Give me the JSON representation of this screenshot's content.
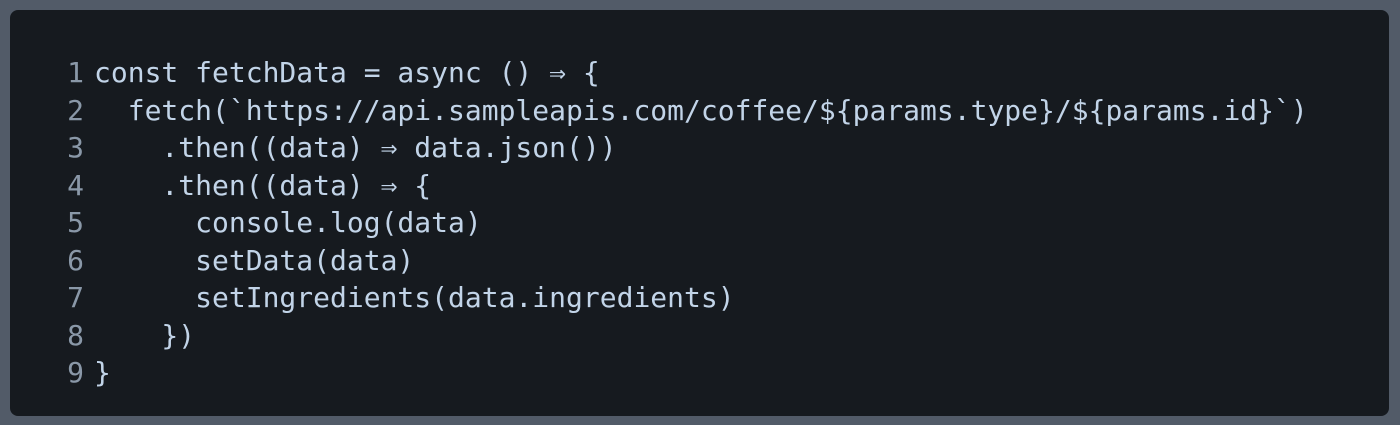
{
  "code_block": {
    "lines": [
      {
        "number": "1",
        "text": "const fetchData = async () ⇒ {"
      },
      {
        "number": "2",
        "text": "  fetch(`https://api.sampleapis.com/coffee/${params.type}/${params.id}`)"
      },
      {
        "number": "3",
        "text": "    .then((data) ⇒ data.json())"
      },
      {
        "number": "4",
        "text": "    .then((data) ⇒ {"
      },
      {
        "number": "5",
        "text": "      console.log(data)"
      },
      {
        "number": "6",
        "text": "      setData(data)"
      },
      {
        "number": "7",
        "text": "      setIngredients(data.ingredients)"
      },
      {
        "number": "8",
        "text": "    })"
      },
      {
        "number": "9",
        "text": "}"
      }
    ],
    "colors": {
      "background": "#161a1f",
      "page_background": "#525b68",
      "code_text": "#c2d4e8",
      "line_number": "#8a98a8"
    }
  }
}
